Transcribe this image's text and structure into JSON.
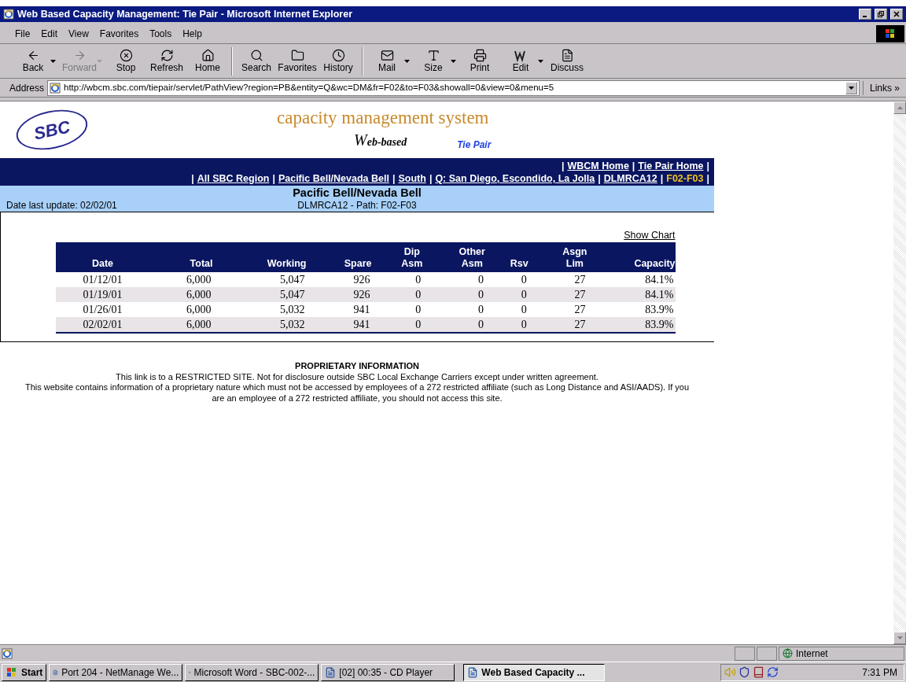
{
  "window": {
    "title": "Web Based Capacity Management: Tie Pair - Microsoft Internet Explorer"
  },
  "menu": [
    "File",
    "Edit",
    "View",
    "Favorites",
    "Tools",
    "Help"
  ],
  "toolbar": [
    {
      "label": "Back",
      "dropdown": true,
      "disabled": false
    },
    {
      "label": "Forward",
      "dropdown": true,
      "disabled": true
    },
    {
      "label": "Stop",
      "dropdown": false,
      "disabled": false
    },
    {
      "label": "Refresh",
      "dropdown": false,
      "disabled": false
    },
    {
      "label": "Home",
      "dropdown": false,
      "disabled": false
    },
    {
      "label": "Search",
      "dropdown": false,
      "disabled": false
    },
    {
      "label": "Favorites",
      "dropdown": false,
      "disabled": false
    },
    {
      "label": "History",
      "dropdown": false,
      "disabled": false
    },
    {
      "label": "Mail",
      "dropdown": true,
      "disabled": false
    },
    {
      "label": "Size",
      "dropdown": true,
      "disabled": false
    },
    {
      "label": "Print",
      "dropdown": false,
      "disabled": false
    },
    {
      "label": "Edit",
      "dropdown": true,
      "disabled": false
    },
    {
      "label": "Discuss",
      "dropdown": false,
      "disabled": false
    }
  ],
  "address": {
    "label": "Address",
    "value": "http://wbcm.sbc.com/tiepair/servlet/PathView?region=PB&entity=Q&wc=DM&fr=F02&to=F03&showall=0&view=0&menu=5",
    "links": "Links",
    "links_chevron": "»"
  },
  "page": {
    "logo": "SBC",
    "brand": "capacity management system",
    "brand_sub": "eb-based",
    "brand_letter": "W",
    "product": "Tie Pair",
    "separator": "|",
    "top_links": [
      "WBCM Home",
      "Tie Pair Home"
    ],
    "breadcrumb": [
      {
        "label": "All SBC Region",
        "selected": false
      },
      {
        "label": "Pacific Bell/Nevada Bell",
        "selected": false
      },
      {
        "label": "South",
        "selected": false
      },
      {
        "label": "Q: San Diego, Escondido, La Jolla",
        "selected": false
      },
      {
        "label": "DLMRCA12",
        "selected": false
      },
      {
        "label": "F02-F03",
        "selected": true
      }
    ],
    "heading": "Pacific Bell/Nevada Bell",
    "subheading": "DLMRCA12 - Path: F02-F03",
    "date_last_update": "Date last update: 02/02/01",
    "show_chart": "Show Chart",
    "table": {
      "columns": [
        "Date",
        "Total",
        "Working",
        "Spare",
        "Dip Asm",
        "Other Asm",
        "Rsv",
        "Asgn Lim",
        "Capacity"
      ],
      "rows": [
        [
          "01/12/01",
          "6,000",
          "5,047",
          "926",
          "0",
          "0",
          "0",
          "27",
          "84.1%"
        ],
        [
          "01/19/01",
          "6,000",
          "5,047",
          "926",
          "0",
          "0",
          "0",
          "27",
          "84.1%"
        ],
        [
          "01/26/01",
          "6,000",
          "5,032",
          "941",
          "0",
          "0",
          "0",
          "27",
          "83.9%"
        ],
        [
          "02/02/01",
          "6,000",
          "5,032",
          "941",
          "0",
          "0",
          "0",
          "27",
          "83.9%"
        ]
      ]
    },
    "notice": {
      "title": "PROPRIETARY INFORMATION",
      "lines": [
        "This link is to a RESTRICTED SITE. Not for disclosure outside SBC Local Exchange Carriers except under written agreement.",
        "This website contains information of a proprietary nature which must not be accessed by employees of a 272 restricted affiliate (such as Long Distance and ASI/AADS). If you are an employee of a 272 restricted affiliate, you should not access this site."
      ]
    }
  },
  "status_bar": {
    "zone": "Internet"
  },
  "taskbar": {
    "start": "Start",
    "tasks": [
      {
        "label": "Port 204 - NetManage We...",
        "selected": false
      },
      {
        "label": "Microsoft Word - SBC-002-...",
        "selected": false
      },
      {
        "label": "[02] 00:35 - CD Player",
        "selected": false
      },
      {
        "label": "Web Based Capacity ...",
        "selected": true
      }
    ],
    "clock": "7:31 PM"
  }
}
